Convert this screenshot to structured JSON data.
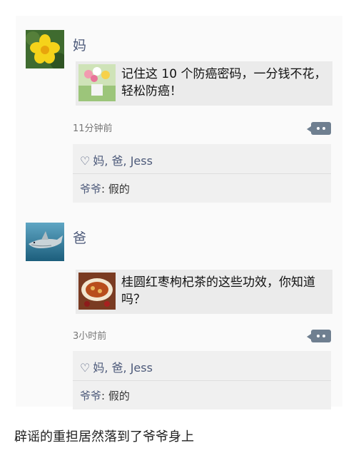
{
  "posts": [
    {
      "author": "妈",
      "avatar_icon": "yellow-flower-avatar",
      "share_title": "记住这 10 个防癌密码，一分钱不花，轻松防癌！",
      "share_thumb_icon": "flower-pot-thumbnail",
      "time": "11分钟前",
      "likes": "妈, 爸, Jess",
      "comment": {
        "name": "爷爷",
        "separator": ": ",
        "text": "假的"
      }
    },
    {
      "author": "爸",
      "avatar_icon": "shark-avatar",
      "share_title": "桂圆红枣枸杞茶的这些功效，你知道吗？",
      "share_thumb_icon": "tea-bowl-thumbnail",
      "time": "3小时前",
      "likes": "妈, 爸, Jess",
      "comment": {
        "name": "爷爷",
        "separator": ": ",
        "text": "假的"
      }
    }
  ],
  "caption": "辟谣的重担居然落到了爷爷身上",
  "colors": {
    "name_link": "#4d5a7a",
    "share_bg": "#ebebeb",
    "comment_button": "#6f7f90"
  }
}
